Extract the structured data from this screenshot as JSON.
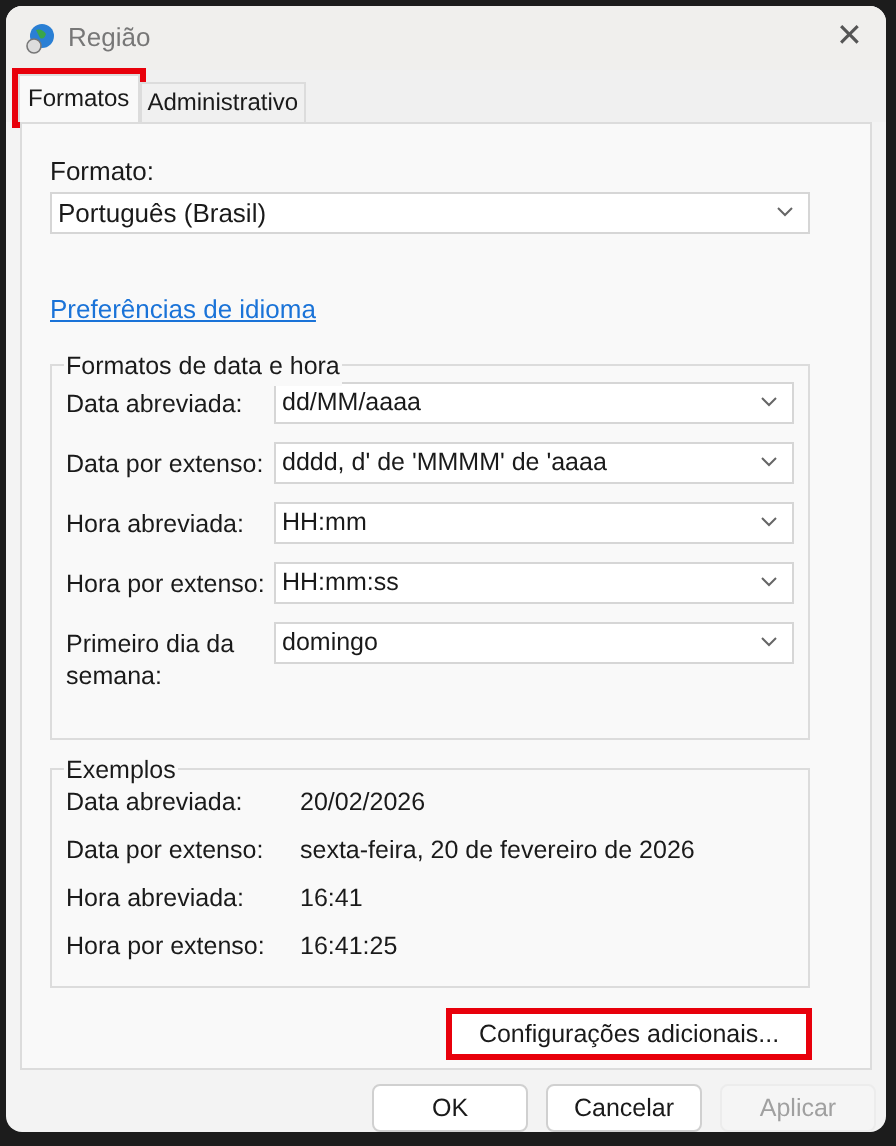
{
  "window": {
    "title": "Região",
    "close": "✕"
  },
  "tabs": [
    {
      "label": "Formatos",
      "selected": true,
      "highlighted": true
    },
    {
      "label": "Administrativo",
      "selected": false,
      "highlighted": false
    }
  ],
  "format": {
    "label": "Formato:",
    "value": "Português (Brasil)"
  },
  "language_link": "Preferências de idioma",
  "date_time_formats": {
    "title": "Formatos de data e hora",
    "rows": [
      {
        "label": "Data abreviada:",
        "value": "dd/MM/aaaa"
      },
      {
        "label": "Data por extenso:",
        "value": "dddd, d' de 'MMMM' de 'aaaa"
      },
      {
        "label": "Hora abreviada:",
        "value": "HH:mm"
      },
      {
        "label": "Hora por extenso:",
        "value": "HH:mm:ss"
      },
      {
        "label": "Primeiro dia da semana:",
        "value": "domingo"
      }
    ]
  },
  "examples": {
    "title": "Exemplos",
    "rows": [
      {
        "label": "Data abreviada:",
        "value": "20/02/2026"
      },
      {
        "label": "Data por extenso:",
        "value": "sexta-feira, 20 de fevereiro de 2026"
      },
      {
        "label": "Hora abreviada:",
        "value": "16:41"
      },
      {
        "label": "Hora por extenso:",
        "value": "16:41:25"
      }
    ]
  },
  "additional_button": {
    "label": "Configurações adicionais...",
    "highlighted": true
  },
  "buttons": [
    {
      "label": "OK",
      "disabled": false
    },
    {
      "label": "Cancelar",
      "disabled": false
    },
    {
      "label": "Aplicar",
      "disabled": true
    }
  ]
}
